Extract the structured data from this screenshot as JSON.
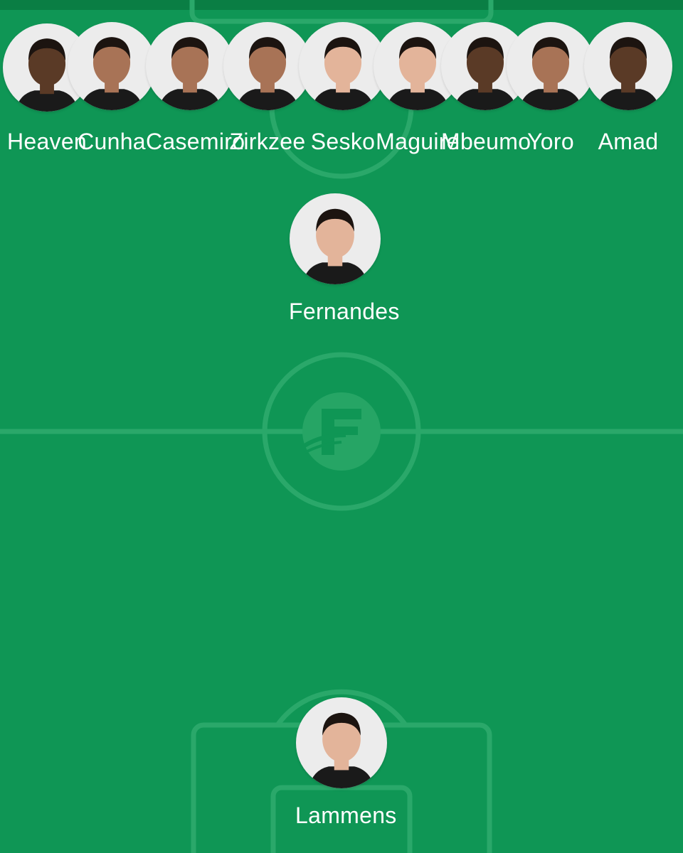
{
  "colors": {
    "pitch": "#0f9655",
    "pitch_lines": "#2aa86a",
    "avatar_bg": "#ececec",
    "skin_dark": "#5a3a26",
    "skin_medium": "#a87356",
    "skin_light": "#e3b49a",
    "hair": "#1c1410",
    "shirt": "#1a1a1a",
    "text": "#ffffff"
  },
  "pitch": {
    "center_logo_icon": "fotmob-logo-icon"
  },
  "bench": [
    {
      "name": "Heaven",
      "skin": "dark"
    },
    {
      "name": "Cunha",
      "skin": "medium"
    },
    {
      "name": "Casemiro",
      "skin": "medium"
    },
    {
      "name": "Zirkzee",
      "skin": "medium"
    },
    {
      "name": "Sesko",
      "skin": "light"
    },
    {
      "name": "Maguire",
      "skin": "light"
    },
    {
      "name": "Mbeumo",
      "skin": "dark"
    },
    {
      "name": "Yoro",
      "skin": "medium"
    },
    {
      "name": "Amad",
      "skin": "dark"
    }
  ],
  "lineup": {
    "attacking_mid": {
      "name": "Fernandes",
      "skin": "light"
    },
    "goalkeeper": {
      "name": "Lammens",
      "skin": "light"
    }
  }
}
